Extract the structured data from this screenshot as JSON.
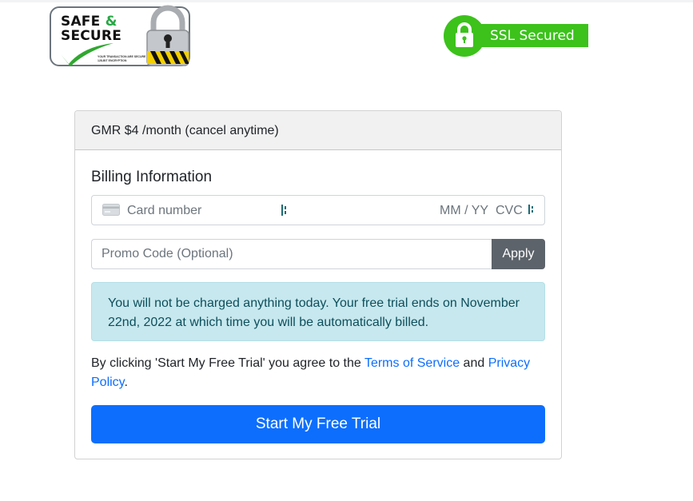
{
  "badges": {
    "safe_secure": {
      "line1": "SAFE",
      "amp": "&",
      "line2": "SECURE",
      "fine_print": "YOUR TRANSACTION ARE SECURE WITH SSL 128-BIT ENCRYPTION"
    },
    "ssl": {
      "label": "SSL Secured"
    }
  },
  "plan": {
    "header": "GMR $4 /month (cancel anytime)"
  },
  "billing": {
    "title": "Billing Information",
    "card_number_placeholder": "Card number",
    "expiry_placeholder": "MM / YY",
    "cvc_placeholder": "CVC"
  },
  "promo": {
    "placeholder": "Promo Code (Optional)",
    "value": "",
    "apply_label": "Apply"
  },
  "notice": {
    "text": "You will not be charged anything today. Your free trial ends on November 22nd, 2022 at which time you will be automatically billed."
  },
  "terms": {
    "prefix": "By clicking 'Start My Free Trial' you agree to the ",
    "terms_link": "Terms of Service",
    "conjunction": " and ",
    "privacy_link": "Privacy Policy",
    "suffix": "."
  },
  "cta": {
    "label": "Start My Free Trial"
  },
  "colors": {
    "primary": "#0d6efd",
    "secondary": "#5c636a",
    "info_bg": "#c7e8ee",
    "ssl_green": "#3cc21b"
  }
}
